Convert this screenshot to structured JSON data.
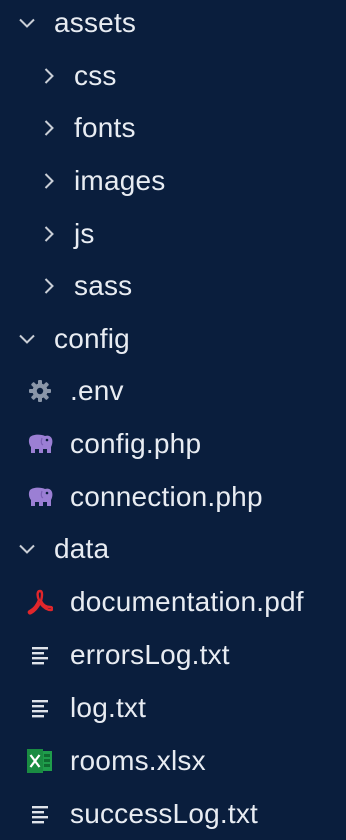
{
  "explorer": {
    "items": [
      {
        "label": "assets",
        "type": "folder-open"
      },
      {
        "label": "css",
        "type": "folder-closed"
      },
      {
        "label": "fonts",
        "type": "folder-closed"
      },
      {
        "label": "images",
        "type": "folder-closed"
      },
      {
        "label": "js",
        "type": "folder-closed"
      },
      {
        "label": "sass",
        "type": "folder-closed"
      },
      {
        "label": "config",
        "type": "folder-open"
      },
      {
        "label": ".env",
        "type": "file",
        "icon": "gear-icon"
      },
      {
        "label": "config.php",
        "type": "file",
        "icon": "php-elephant-icon"
      },
      {
        "label": "connection.php",
        "type": "file",
        "icon": "php-elephant-icon"
      },
      {
        "label": "data",
        "type": "folder-open"
      },
      {
        "label": "documentation.pdf",
        "type": "file",
        "icon": "pdf-icon"
      },
      {
        "label": "errorsLog.txt",
        "type": "file",
        "icon": "text-lines-icon"
      },
      {
        "label": "log.txt",
        "type": "file",
        "icon": "text-lines-icon"
      },
      {
        "label": "rooms.xlsx",
        "type": "file",
        "icon": "excel-icon"
      },
      {
        "label": "successLog.txt",
        "type": "file",
        "icon": "text-lines-icon"
      }
    ]
  },
  "colors": {
    "background": "#0a1e3d",
    "text": "#e8ecf2",
    "chevron": "#c9ced6",
    "gear": "#8a96a8",
    "php": "#9b7fd4",
    "pdf": "#e0262b",
    "excel": "#1f9d4b",
    "text_icon": "#dfe3ea"
  }
}
